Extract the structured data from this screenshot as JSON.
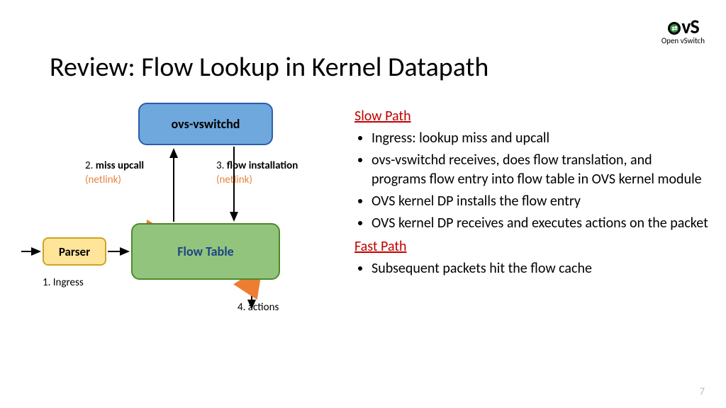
{
  "logo": {
    "text": "OvS",
    "subtitle": "Open vSwitch"
  },
  "title": "Review: Flow Lookup in Kernel Datapath",
  "diagram": {
    "vswitchd": "ovs-vswitchd",
    "flowtable": "Flow Table",
    "parser": "Parser",
    "labels": {
      "miss_num": "2.",
      "miss_text": "miss upcall",
      "miss_sub": "(netlink)",
      "install_num": "3.",
      "install_text": "flow installation",
      "install_sub": "(netlink)",
      "ingress": "1. Ingress",
      "actions": "4. actions"
    }
  },
  "text": {
    "slow_head": "Slow Path",
    "slow_items": [
      "Ingress: lookup miss and upcall",
      "ovs-vswitchd receives, does flow translation, and programs flow entry into flow table in OVS kernel module",
      "OVS kernel DP installs the flow entry",
      "OVS kernel DP receives and executes actions on the packet"
    ],
    "fast_head": "Fast Path",
    "fast_items": [
      "Subsequent packets hit the flow cache"
    ]
  },
  "page": "7"
}
